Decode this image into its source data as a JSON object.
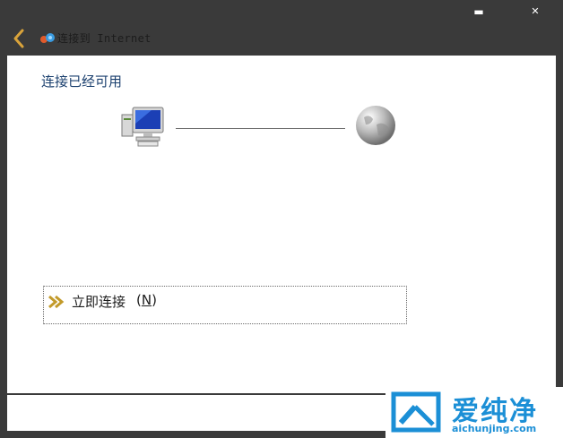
{
  "window": {
    "minimize_label": "▬",
    "close_label": "✕",
    "title": "连接到 Internet"
  },
  "main": {
    "heading": "连接已经可用",
    "connect_label": "立即连接",
    "connect_key_open": "(",
    "connect_key_letter": "N",
    "connect_key_close": ")"
  },
  "watermark": {
    "brand_cn": "爱纯净",
    "brand_url": "aichunjing.com"
  },
  "colors": {
    "accent": "#1a3f6e",
    "watermark_blue": "#1b8fd6",
    "arrow_gold": "#c29a2a"
  }
}
